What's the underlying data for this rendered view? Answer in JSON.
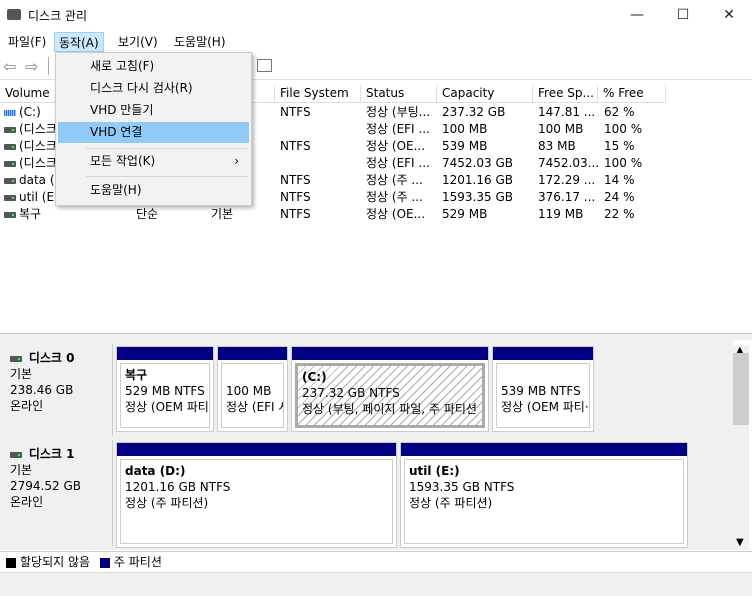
{
  "window": {
    "title": "디스크 관리",
    "icon": "disk-management-icon",
    "minimize": "—",
    "maximize": "☐",
    "close": "✕"
  },
  "menu": [
    {
      "label": "파일(F)"
    },
    {
      "label": "동작(A)"
    },
    {
      "label": "보기(V)"
    },
    {
      "label": "도움말(H)"
    }
  ],
  "dropdown": {
    "items": [
      {
        "label": "새로 고침(F)"
      },
      {
        "label": "디스크 다시 검사(R)"
      },
      {
        "label": "VHD 만들기"
      },
      {
        "label": "VHD 연결",
        "highlighted": true
      },
      {
        "label": "모든 작업(K)",
        "submenu": "›"
      },
      {
        "label": "도움말(H)"
      }
    ]
  },
  "toolbar": {
    "back": "back-arrow-icon",
    "forward": "forward-arrow-icon",
    "properties": "properties-icon"
  },
  "list": {
    "columns": [
      "Volume",
      "File System",
      "Status",
      "Capacity",
      "Free Sp...",
      "% Free"
    ],
    "rows": [
      {
        "volume": "(C:)",
        "layout": "",
        "type": "",
        "fs": "NTFS",
        "status": "정상 (부팅...",
        "capacity": "237.32 GB",
        "free": "147.81 ...",
        "pct": "62 %",
        "icon": "sys"
      },
      {
        "volume": "(디스크",
        "layout": "",
        "type": "",
        "fs": "",
        "status": "정상 (EFI ...",
        "capacity": "100 MB",
        "free": "100 MB",
        "pct": "100 %"
      },
      {
        "volume": "(디스크",
        "layout": "",
        "type": "",
        "fs": "NTFS",
        "status": "정상 (OE...",
        "capacity": "539 MB",
        "free": "83 MB",
        "pct": "15 %"
      },
      {
        "volume": "(디스크",
        "layout": "",
        "type": "",
        "fs": "",
        "status": "정상 (EFI ...",
        "capacity": "7452.03 GB",
        "free": "7452.03...",
        "pct": "100 %"
      },
      {
        "volume": "data (D",
        "layout": "",
        "type": "",
        "fs": "NTFS",
        "status": "정상 (주 ...",
        "capacity": "1201.16 GB",
        "free": "172.29 ...",
        "pct": "14 %"
      },
      {
        "volume": "util (E:",
        "layout": "",
        "type": "",
        "fs": "NTFS",
        "status": "정상 (주 ...",
        "capacity": "1593.35 GB",
        "free": "376.17 ...",
        "pct": "24 %"
      },
      {
        "volume": "복구",
        "layout": "단순",
        "type": "기본",
        "fs": "NTFS",
        "status": "정상 (OE...",
        "capacity": "529 MB",
        "free": "119 MB",
        "pct": "22 %"
      }
    ]
  },
  "disks": [
    {
      "name": "디스크 0",
      "type": "기본",
      "size": "238.46 GB",
      "state": "온라인",
      "partitions": [
        {
          "title": "복구",
          "line1": "529 MB NTFS",
          "line2": "정상 (OEM 파티"
        },
        {
          "title": "",
          "line1": "100 MB",
          "line2": "정상 (EFI 시"
        },
        {
          "title": "(C:)",
          "line1": "237.32 GB NTFS",
          "line2": "정상 (부팅, 페이지 파일, 주 파티션",
          "selected": true
        },
        {
          "title": "",
          "line1": "539 MB NTFS",
          "line2": "정상 (OEM 파티·"
        }
      ]
    },
    {
      "name": "디스크 1",
      "type": "기본",
      "size": "2794.52 GB",
      "state": "온라인",
      "partitions": [
        {
          "title": "data  (D:)",
          "line1": "1201.16 GB NTFS",
          "line2": "정상 (주 파티션)"
        },
        {
          "title": "util  (E:)",
          "line1": "1593.35 GB NTFS",
          "line2": "정상 (주 파티션)"
        }
      ]
    }
  ],
  "legend": [
    {
      "label": "할당되지 않음",
      "color": "#000000"
    },
    {
      "label": "주 파티션",
      "color": "#000080"
    }
  ]
}
